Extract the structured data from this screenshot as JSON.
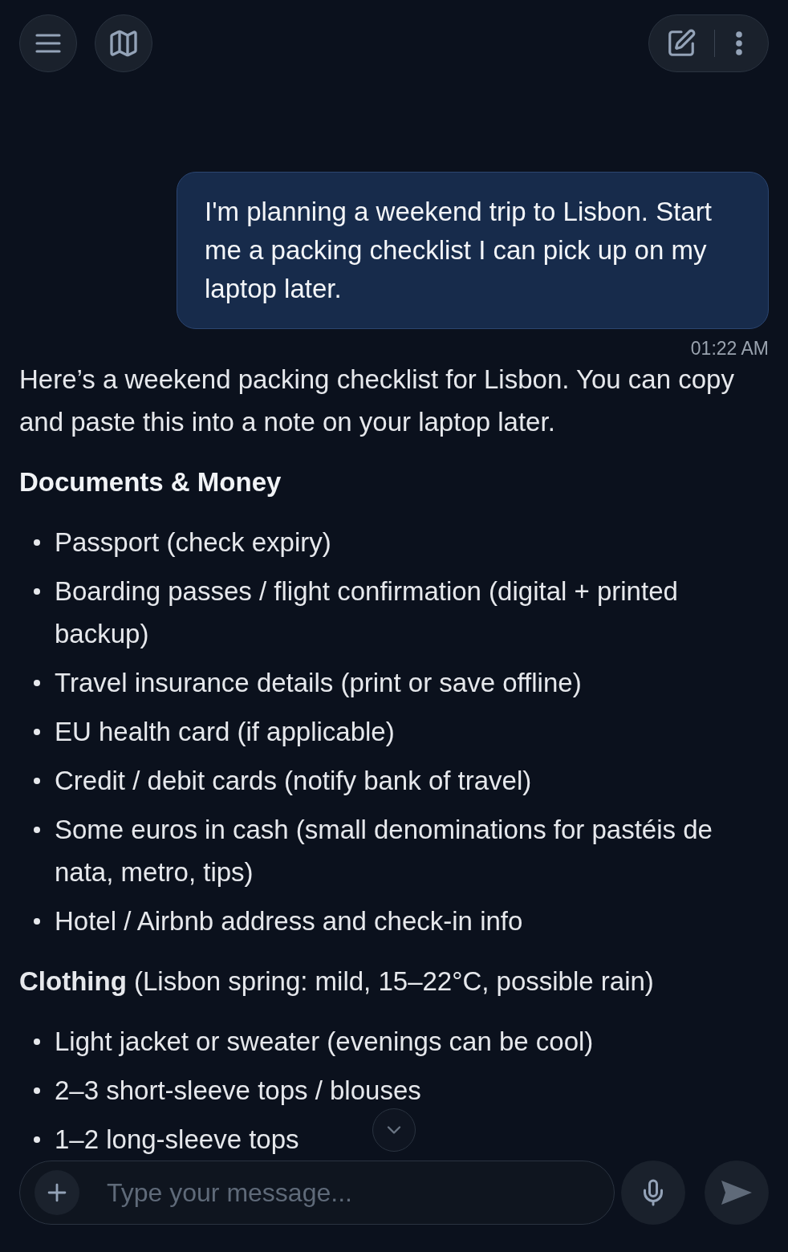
{
  "messages": [
    {
      "kind": "user",
      "text": "I'm planning a weekend trip to Lisbon. Start me a packing checklist I can pick up on my laptop later.",
      "time": "01:22 AM"
    },
    {
      "kind": "assistant",
      "blocks": [
        {
          "kind": "paragraph",
          "text": "Here’s a weekend packing checklist for Lisbon. You can copy and paste this into a note on your laptop later."
        },
        {
          "kind": "heading",
          "text": "Documents & Money"
        },
        {
          "kind": "list",
          "items": [
            "Passport (check expiry)",
            "Boarding passes / flight confirmation (digital + printed backup)",
            "Travel insurance details (print or save offline)",
            "EU health card (if applicable)",
            "Credit / debit cards (notify bank of travel)",
            "Some euros in cash (small denominations for pastéis de nata, metro, tips)",
            "Hotel / Airbnb address and check-in info"
          ]
        },
        {
          "kind": "paragraph",
          "text": "**Clothing** (Lisbon spring: mild, 15–22°C, possible rain)"
        },
        {
          "kind": "list",
          "items": [
            "Light jacket or sweater (evenings can be cool)",
            "2–3 short-sleeve tops / blouses",
            "1–2 long-sleeve tops"
          ]
        }
      ]
    }
  ],
  "composer": {
    "placeholder": "Type your message..."
  }
}
